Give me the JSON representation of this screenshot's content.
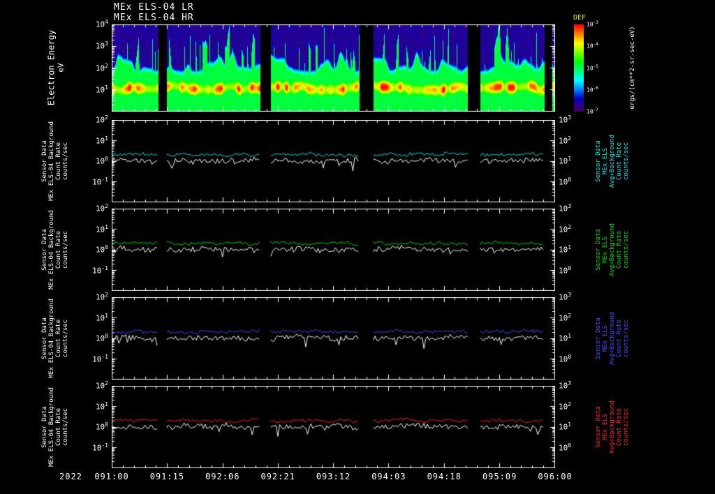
{
  "header": {
    "title_lr": "MEx ELS-04 LR",
    "title_hr": "MEx ELS-04 HR"
  },
  "spectrogram_axis": {
    "ylabel": "Electron Energy",
    "yunit": "eV"
  },
  "colorbar": {
    "title": "DEF",
    "unit": "ergs/(cm**2-sr-sec-eV)"
  },
  "labels": {
    "left_lines": [
      "Sensor Data",
      "MEx ELS-04 Background",
      "Count Rate",
      "counts/sec"
    ],
    "right_lines": [
      "Sensor Data",
      "MEx ELS Avg+Background",
      "Count Rate",
      "counts/sec"
    ]
  },
  "axes": {
    "spectro_y_exponents": [
      4,
      3,
      2,
      1
    ],
    "panel_left_exponents": [
      2,
      1,
      0,
      -1
    ],
    "panel_right_exponents": [
      3,
      2,
      1,
      0
    ],
    "colorbar_exponents": [
      -3,
      -4,
      -5,
      -6,
      -7
    ]
  },
  "chart_data": {
    "time_axis": {
      "year": "2022",
      "format": "DOY:HH",
      "ticks": [
        "091:00",
        "091:15",
        "092:06",
        "092:21",
        "093:12",
        "094:03",
        "094:18",
        "095:09",
        "096:00"
      ]
    },
    "data_gaps_frac": [
      [
        0.105,
        0.124
      ],
      [
        0.335,
        0.359
      ],
      [
        0.559,
        0.59
      ],
      [
        0.803,
        0.831
      ],
      [
        0.975,
        0.993
      ]
    ],
    "data_segments_frac": [
      [
        0,
        0.105
      ],
      [
        0.124,
        0.335
      ],
      [
        0.359,
        0.559
      ],
      [
        0.59,
        0.803
      ],
      [
        0.831,
        0.975
      ],
      [
        0.993,
        1
      ]
    ],
    "spectrogram": {
      "type": "heatmap",
      "title": "MEx ELS-04 LR/HR electron energy spectrogram",
      "ylabel": "Electron Energy (eV)",
      "y_log_range": [
        0,
        4
      ],
      "colormap": "rainbow",
      "colorbar_label": "DEF",
      "colorbar_unit": "ergs/(cm**2-sr-sec-eV)",
      "colorbar_log_range": [
        -7,
        -3
      ],
      "peak_flux_energy_eV": [
        8,
        40
      ],
      "seed": 1234
    },
    "line_panels": [
      {
        "type": "line",
        "left_ylog_range": [
          -2,
          2
        ],
        "right_ylog_range": [
          -1,
          3
        ],
        "series": [
          {
            "name": "MEx ELS Avg+Background Count Rate",
            "color": "#00e8e8",
            "mean_counts_per_sec": 2.0,
            "noise_dex": 0.09
          },
          {
            "name": "MEx ELS-04 Background Count Rate",
            "color": "#ffffff",
            "mean_counts_per_sec": 1.0,
            "noise_dex": 0.15
          }
        ]
      },
      {
        "type": "line",
        "left_ylog_range": [
          -2,
          2
        ],
        "right_ylog_range": [
          -1,
          3
        ],
        "series": [
          {
            "name": "MEx ELS Avg+Background Count Rate",
            "color": "#00dd00",
            "mean_counts_per_sec": 2.0,
            "noise_dex": 0.09
          },
          {
            "name": "MEx ELS-04 Background Count Rate",
            "color": "#ffffff",
            "mean_counts_per_sec": 1.0,
            "noise_dex": 0.15
          }
        ]
      },
      {
        "type": "line",
        "left_ylog_range": [
          -2,
          2
        ],
        "right_ylog_range": [
          -1,
          3
        ],
        "series": [
          {
            "name": "MEx ELS Avg+Background Count Rate",
            "color": "#4848ff",
            "mean_counts_per_sec": 2.0,
            "noise_dex": 0.09
          },
          {
            "name": "MEx ELS-04 Background Count Rate",
            "color": "#ffffff",
            "mean_counts_per_sec": 1.0,
            "noise_dex": 0.15
          }
        ]
      },
      {
        "type": "line",
        "left_ylog_range": [
          -2,
          2
        ],
        "right_ylog_range": [
          -1,
          3
        ],
        "series": [
          {
            "name": "MEx ELS Avg+Background Count Rate",
            "color": "#ff2020",
            "mean_counts_per_sec": 2.0,
            "noise_dex": 0.09
          },
          {
            "name": "MEx ELS-04 Background Count Rate",
            "color": "#ffffff",
            "mean_counts_per_sec": 1.0,
            "noise_dex": 0.15
          }
        ]
      }
    ]
  }
}
